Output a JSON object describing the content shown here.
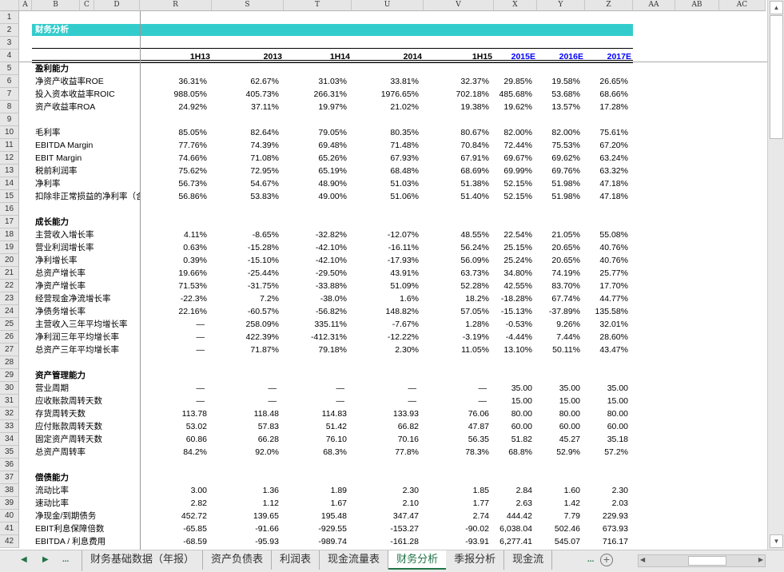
{
  "columns": [
    "A",
    "B",
    "C",
    "D",
    "R",
    "S",
    "T",
    "U",
    "V",
    "X",
    "Y",
    "Z",
    "AA",
    "AB",
    "AC"
  ],
  "title": "财务分析",
  "periods": [
    "1H13",
    "2013",
    "1H14",
    "2014",
    "1H15",
    "2015E",
    "2016E",
    "2017E"
  ],
  "forecast_color": "#0000ff",
  "band_color": "#33cccc",
  "rows": [
    {
      "n": "1"
    },
    {
      "n": "2"
    },
    {
      "n": "3"
    },
    {
      "n": "4"
    },
    {
      "n": "5",
      "label": "盈利能力",
      "bold": true
    },
    {
      "n": "6",
      "label": "净资产收益率ROE",
      "v": [
        "36.31%",
        "62.67%",
        "31.03%",
        "33.81%",
        "32.37%",
        "29.85%",
        "19.58%",
        "26.65%"
      ]
    },
    {
      "n": "7",
      "label": "投入资本收益率ROIC",
      "v": [
        "988.05%",
        "405.73%",
        "266.31%",
        "1976.65%",
        "702.18%",
        "485.68%",
        "53.68%",
        "68.66%"
      ]
    },
    {
      "n": "8",
      "label": "资产收益率ROA",
      "v": [
        "24.92%",
        "37.11%",
        "19.97%",
        "21.02%",
        "19.38%",
        "19.62%",
        "13.57%",
        "17.28%"
      ]
    },
    {
      "n": "9"
    },
    {
      "n": "10",
      "label": "毛利率",
      "v": [
        "85.05%",
        "82.64%",
        "79.05%",
        "80.35%",
        "80.67%",
        "82.00%",
        "82.00%",
        "75.61%"
      ]
    },
    {
      "n": "11",
      "label": "EBITDA Margin",
      "v": [
        "77.76%",
        "74.39%",
        "69.48%",
        "71.48%",
        "70.84%",
        "72.44%",
        "75.53%",
        "67.20%"
      ]
    },
    {
      "n": "12",
      "label": "EBIT Margin",
      "v": [
        "74.66%",
        "71.08%",
        "65.26%",
        "67.93%",
        "67.91%",
        "69.67%",
        "69.62%",
        "63.24%"
      ]
    },
    {
      "n": "13",
      "label": "税前利润率",
      "v": [
        "75.62%",
        "72.95%",
        "65.19%",
        "68.48%",
        "68.69%",
        "69.99%",
        "69.76%",
        "63.32%"
      ]
    },
    {
      "n": "14",
      "label": "净利率",
      "v": [
        "56.73%",
        "54.67%",
        "48.90%",
        "51.03%",
        "51.38%",
        "52.15%",
        "51.98%",
        "47.18%"
      ]
    },
    {
      "n": "15",
      "label": "扣除非正常损益的净利率（含",
      "v": [
        "56.86%",
        "53.83%",
        "49.00%",
        "51.06%",
        "51.40%",
        "52.15%",
        "51.98%",
        "47.18%"
      ]
    },
    {
      "n": "16"
    },
    {
      "n": "17",
      "label": "成长能力",
      "bold": true
    },
    {
      "n": "18",
      "label": "主营收入增长率",
      "v": [
        "4.11%",
        "-8.65%",
        "-32.82%",
        "-12.07%",
        "48.55%",
        "22.54%",
        "21.05%",
        "55.08%"
      ]
    },
    {
      "n": "19",
      "label": "营业利润增长率",
      "v": [
        "0.63%",
        "-15.28%",
        "-42.10%",
        "-16.11%",
        "56.24%",
        "25.15%",
        "20.65%",
        "40.76%"
      ]
    },
    {
      "n": "20",
      "label": "净利增长率",
      "v": [
        "0.39%",
        "-15.10%",
        "-42.10%",
        "-17.93%",
        "56.09%",
        "25.24%",
        "20.65%",
        "40.76%"
      ]
    },
    {
      "n": "21",
      "label": "总资产增长率",
      "v": [
        "19.66%",
        "-25.44%",
        "-29.50%",
        "43.91%",
        "63.73%",
        "34.80%",
        "74.19%",
        "25.77%"
      ]
    },
    {
      "n": "22",
      "label": "净资产增长率",
      "v": [
        "71.53%",
        "-31.75%",
        "-33.88%",
        "51.09%",
        "52.28%",
        "42.55%",
        "83.70%",
        "17.70%"
      ]
    },
    {
      "n": "23",
      "label": "经营现金净流增长率",
      "v": [
        "-22.3%",
        "7.2%",
        "-38.0%",
        "1.6%",
        "18.2%",
        "-18.28%",
        "67.74%",
        "44.77%"
      ]
    },
    {
      "n": "24",
      "label": "净债务增长率",
      "v": [
        "22.16%",
        "-60.57%",
        "-56.82%",
        "148.82%",
        "57.05%",
        "-15.13%",
        "-37.89%",
        "135.58%"
      ]
    },
    {
      "n": "25",
      "label": "主营收入三年平均增长率",
      "v": [
        "—",
        "258.09%",
        "335.11%",
        "-7.67%",
        "1.28%",
        "-0.53%",
        "9.26%",
        "32.01%"
      ]
    },
    {
      "n": "26",
      "label": "净利润三年平均增长率",
      "v": [
        "—",
        "422.39%",
        "-412.31%",
        "-12.22%",
        "-3.19%",
        "-4.44%",
        "7.44%",
        "28.60%"
      ]
    },
    {
      "n": "27",
      "label": "总资产三年平均增长率",
      "v": [
        "—",
        "71.87%",
        "79.18%",
        "2.30%",
        "11.05%",
        "13.10%",
        "50.11%",
        "43.47%"
      ]
    },
    {
      "n": "28"
    },
    {
      "n": "29",
      "label": "资产管理能力",
      "bold": true
    },
    {
      "n": "30",
      "label": "营业周期",
      "v": [
        "—",
        "—",
        "—",
        "—",
        "—",
        "35.00",
        "35.00",
        "35.00"
      ]
    },
    {
      "n": "31",
      "label": "应收账款周转天数",
      "v": [
        "—",
        "—",
        "—",
        "—",
        "—",
        "15.00",
        "15.00",
        "15.00"
      ]
    },
    {
      "n": "32",
      "label": "存货周转天数",
      "v": [
        "113.78",
        "118.48",
        "114.83",
        "133.93",
        "76.06",
        "80.00",
        "80.00",
        "80.00"
      ]
    },
    {
      "n": "33",
      "label": "应付账款周转天数",
      "v": [
        "53.02",
        "57.83",
        "51.42",
        "66.82",
        "47.87",
        "60.00",
        "60.00",
        "60.00"
      ]
    },
    {
      "n": "34",
      "label": "固定资产周转天数",
      "v": [
        "60.86",
        "66.28",
        "76.10",
        "70.16",
        "56.35",
        "51.82",
        "45.27",
        "35.18"
      ]
    },
    {
      "n": "35",
      "label": "总资产周转率",
      "v": [
        "84.2%",
        "92.0%",
        "68.3%",
        "77.8%",
        "78.3%",
        "68.8%",
        "52.9%",
        "57.2%"
      ]
    },
    {
      "n": "36"
    },
    {
      "n": "37",
      "label": "偿债能力",
      "bold": true
    },
    {
      "n": "38",
      "label": "流动比率",
      "v": [
        "3.00",
        "1.36",
        "1.89",
        "2.30",
        "1.85",
        "2.84",
        "1.60",
        "2.30"
      ]
    },
    {
      "n": "39",
      "label": "速动比率",
      "v": [
        "2.82",
        "1.12",
        "1.67",
        "2.10",
        "1.77",
        "2.63",
        "1.42",
        "2.03"
      ]
    },
    {
      "n": "40",
      "label": "净现金/到期债务",
      "v": [
        "452.72",
        "139.65",
        "195.48",
        "347.47",
        "2.74",
        "444.42",
        "7.79",
        "229.93"
      ]
    },
    {
      "n": "41",
      "label": "EBIT利息保障倍数",
      "v": [
        "-65.85",
        "-91.66",
        "-929.55",
        "-153.27",
        "-90.02",
        "6,038.04",
        "502.46",
        "673.93"
      ]
    },
    {
      "n": "42",
      "label": "EBITDA / 利息费用",
      "v": [
        "-68.59",
        "-95.93",
        "-989.74",
        "-161.28",
        "-93.91",
        "6,277.41",
        "545.07",
        "716.17"
      ]
    }
  ],
  "tabs": {
    "nav_more": "...",
    "items": [
      "财务基础数据（年报）",
      "资产负债表",
      "利润表",
      "现金流量表",
      "财务分析",
      "季报分析",
      "现金流"
    ],
    "active": 4,
    "more": "...",
    "add": "+"
  }
}
